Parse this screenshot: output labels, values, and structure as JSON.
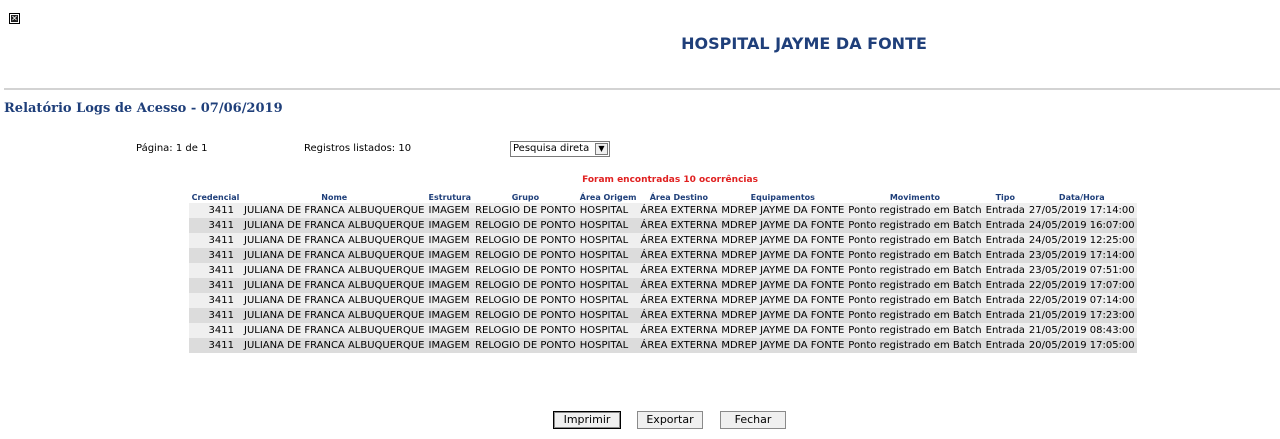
{
  "header": {
    "close_icon": "close-icon",
    "title": "HOSPITAL JAYME DA FONTE"
  },
  "report": {
    "title": "Relatório Logs de Acesso - 07/06/2019",
    "page_info": "Página: 1 de 1",
    "records_info": "Registros listados: 10",
    "search_mode": "Pesquisa direta",
    "found_message": "Foram encontradas 10 ocorrências"
  },
  "table": {
    "headers": [
      "Credencial",
      "Nome",
      "Estrutura",
      "Grupo",
      "Área Origem",
      "Área Destino",
      "Equipamentos",
      "Movimento",
      "Tipo",
      "Data/Hora"
    ],
    "rows": [
      [
        "3411",
        "JULIANA DE FRANCA ALBUQUERQUE",
        "IMAGEM",
        "RELOGIO DE PONTO",
        "HOSPITAL",
        "ÁREA EXTERNA",
        "MDREP JAYME DA FONTE",
        "Ponto registrado em Batch",
        "Entrada",
        "27/05/2019 17:14:00"
      ],
      [
        "3411",
        "JULIANA DE FRANCA ALBUQUERQUE",
        "IMAGEM",
        "RELOGIO DE PONTO",
        "HOSPITAL",
        "ÁREA EXTERNA",
        "MDREP JAYME DA FONTE",
        "Ponto registrado em Batch",
        "Entrada",
        "24/05/2019 16:07:00"
      ],
      [
        "3411",
        "JULIANA DE FRANCA ALBUQUERQUE",
        "IMAGEM",
        "RELOGIO DE PONTO",
        "HOSPITAL",
        "ÁREA EXTERNA",
        "MDREP JAYME DA FONTE",
        "Ponto registrado em Batch",
        "Entrada",
        "24/05/2019 12:25:00"
      ],
      [
        "3411",
        "JULIANA DE FRANCA ALBUQUERQUE",
        "IMAGEM",
        "RELOGIO DE PONTO",
        "HOSPITAL",
        "ÁREA EXTERNA",
        "MDREP JAYME DA FONTE",
        "Ponto registrado em Batch",
        "Entrada",
        "23/05/2019 17:14:00"
      ],
      [
        "3411",
        "JULIANA DE FRANCA ALBUQUERQUE",
        "IMAGEM",
        "RELOGIO DE PONTO",
        "HOSPITAL",
        "ÁREA EXTERNA",
        "MDREP JAYME DA FONTE",
        "Ponto registrado em Batch",
        "Entrada",
        "23/05/2019 07:51:00"
      ],
      [
        "3411",
        "JULIANA DE FRANCA ALBUQUERQUE",
        "IMAGEM",
        "RELOGIO DE PONTO",
        "HOSPITAL",
        "ÁREA EXTERNA",
        "MDREP JAYME DA FONTE",
        "Ponto registrado em Batch",
        "Entrada",
        "22/05/2019 17:07:00"
      ],
      [
        "3411",
        "JULIANA DE FRANCA ALBUQUERQUE",
        "IMAGEM",
        "RELOGIO DE PONTO",
        "HOSPITAL",
        "ÁREA EXTERNA",
        "MDREP JAYME DA FONTE",
        "Ponto registrado em Batch",
        "Entrada",
        "22/05/2019 07:14:00"
      ],
      [
        "3411",
        "JULIANA DE FRANCA ALBUQUERQUE",
        "IMAGEM",
        "RELOGIO DE PONTO",
        "HOSPITAL",
        "ÁREA EXTERNA",
        "MDREP JAYME DA FONTE",
        "Ponto registrado em Batch",
        "Entrada",
        "21/05/2019 17:23:00"
      ],
      [
        "3411",
        "JULIANA DE FRANCA ALBUQUERQUE",
        "IMAGEM",
        "RELOGIO DE PONTO",
        "HOSPITAL",
        "ÁREA EXTERNA",
        "MDREP JAYME DA FONTE",
        "Ponto registrado em Batch",
        "Entrada",
        "21/05/2019 08:43:00"
      ],
      [
        "3411",
        "JULIANA DE FRANCA ALBUQUERQUE",
        "IMAGEM",
        "RELOGIO DE PONTO",
        "HOSPITAL",
        "ÁREA EXTERNA",
        "MDREP JAYME DA FONTE",
        "Ponto registrado em Batch",
        "Entrada",
        "20/05/2019 17:05:00"
      ]
    ]
  },
  "buttons": {
    "print": "Imprimir",
    "export": "Exportar",
    "close": "Fechar"
  },
  "colors": {
    "title": "#1f3f7a",
    "found_message": "#e02020",
    "row_light": "#efefef",
    "row_dark": "#dcdcdc"
  }
}
